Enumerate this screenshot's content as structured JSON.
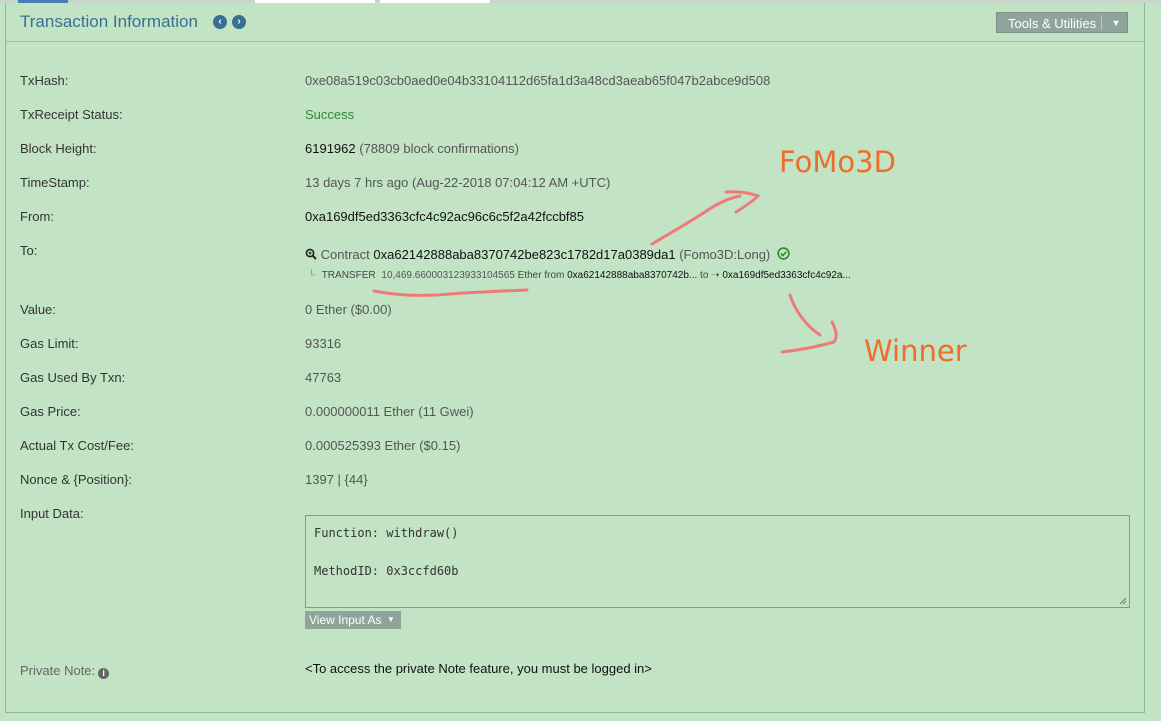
{
  "header": {
    "title": "Transaction Information",
    "prev_icon": "chevron-left-circle-icon",
    "next_icon": "chevron-right-circle-icon",
    "tools_label": "Tools & Utilities"
  },
  "rows": {
    "txhash": {
      "label": "TxHash:",
      "value": "0xe08a519c03cb0aed0e04b33104112d65fa1d3a48cd3aeab65f047b2abce9d508"
    },
    "status": {
      "label": "TxReceipt Status:",
      "value": "Success"
    },
    "block": {
      "label": "Block Height:",
      "number": "6191962",
      "confirmations": "(78809 block confirmations)"
    },
    "timestamp": {
      "label": "TimeStamp:",
      "value": "13 days 7 hrs ago (Aug-22-2018 07:04:12 AM +UTC)"
    },
    "from": {
      "label": "From:",
      "value": "0xa169df5ed3363cfc4c92ac96c6c5f2a42fccbf85"
    },
    "to": {
      "label": "To:",
      "contract_word": "Contract",
      "address": "0xa62142888aba8370742be823c1782d17a0389da1",
      "name": "(Fomo3D:Long)",
      "transfer_prefix": "TRANSFER",
      "transfer_amount": "10,469.660003123933104565",
      "transfer_unit": "Ether from",
      "transfer_from": "0xa62142888aba8370742b...",
      "transfer_to_word": "to",
      "transfer_arrow": "➝",
      "transfer_to": "0xa169df5ed3363cfc4c92a..."
    },
    "value": {
      "label": "Value:",
      "value": "0 Ether ($0.00)"
    },
    "gas_limit": {
      "label": "Gas Limit:",
      "value": "93316"
    },
    "gas_used": {
      "label": "Gas Used By Txn:",
      "value": "47763"
    },
    "gas_price": {
      "label": "Gas Price:",
      "value": "0.000000011 Ether (11 Gwei)"
    },
    "fee": {
      "label": "Actual Tx Cost/Fee:",
      "value": "0.000525393 Ether ($0.15)"
    },
    "nonce": {
      "label": "Nonce & {Position}:",
      "value": "1397 | {44}"
    },
    "input": {
      "label": "Input Data:",
      "line1": "Function: withdraw()",
      "line2": "MethodID: 0x3ccfd60b",
      "view_as_label": "View Input As"
    },
    "note": {
      "label": "Private Note:",
      "value": "<To access the private Note feature, you must be logged in>"
    }
  },
  "annotations": {
    "fomo": "FoMo3D",
    "winner": "Winner",
    "color": "#ef6d2a",
    "scribble_color": "#f07a7a"
  },
  "colors": {
    "background": "#c2e4c5",
    "title": "#3a6f93",
    "success": "#2d8a2d",
    "button": "#8fa49a"
  }
}
